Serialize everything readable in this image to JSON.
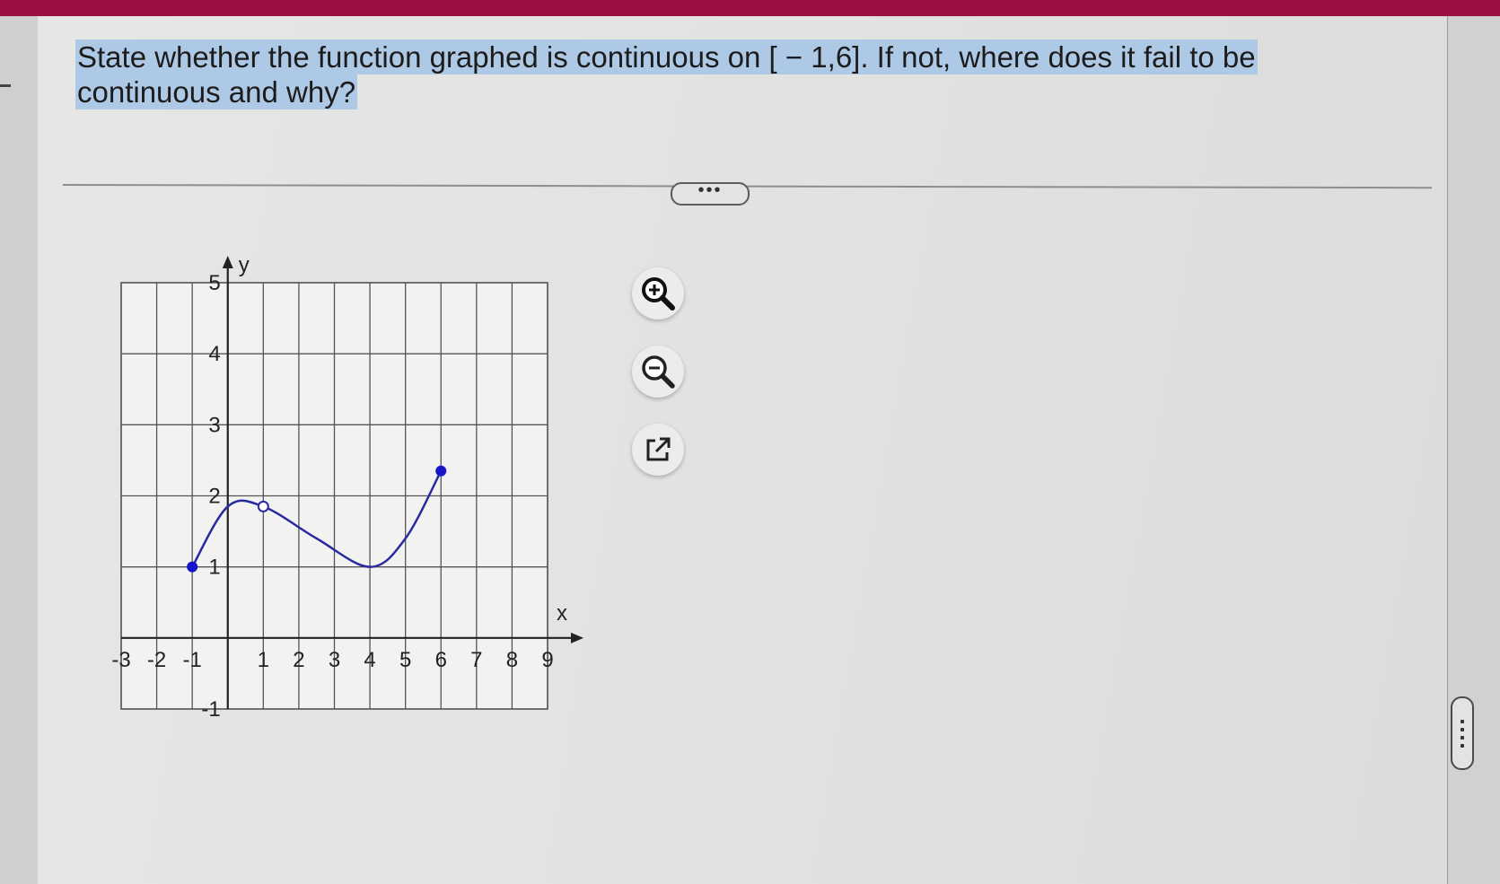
{
  "question": {
    "line1": "State whether the function graphed is continuous on [ − 1,6]. If not, where does it fail to be",
    "line2": "continuous and why?"
  },
  "more_button": {
    "label": "•••"
  },
  "graph": {
    "x_axis_label": "x",
    "y_axis_label": "y",
    "x_ticks": [
      "-3",
      "-2",
      "-1",
      "1",
      "2",
      "3",
      "4",
      "5",
      "6",
      "7",
      "8",
      "9"
    ],
    "y_ticks": [
      "5",
      "4",
      "3",
      "2",
      "1",
      "-1"
    ],
    "x_range": [
      -3,
      9
    ],
    "y_range": [
      -1,
      5
    ],
    "curve_color": "#2a2aa0",
    "function_points": [
      {
        "x": -1,
        "y": 1,
        "marker": "closed"
      },
      {
        "x": 0,
        "y": 1.85
      },
      {
        "x": 1,
        "y": 1.85,
        "marker": "open"
      },
      {
        "x": 2.5,
        "y": 1.4
      },
      {
        "x": 4,
        "y": 1
      },
      {
        "x": 5,
        "y": 1.4
      },
      {
        "x": 6,
        "y": 2.35,
        "marker": "closed"
      }
    ]
  },
  "toolbar": {
    "zoom_in_icon": "magnifier-plus-icon",
    "zoom_out_icon": "magnifier-minus-icon",
    "open_external_icon": "external-link-icon"
  },
  "colors": {
    "top_bar": "#9a1042",
    "highlight": "#aec9e6"
  }
}
